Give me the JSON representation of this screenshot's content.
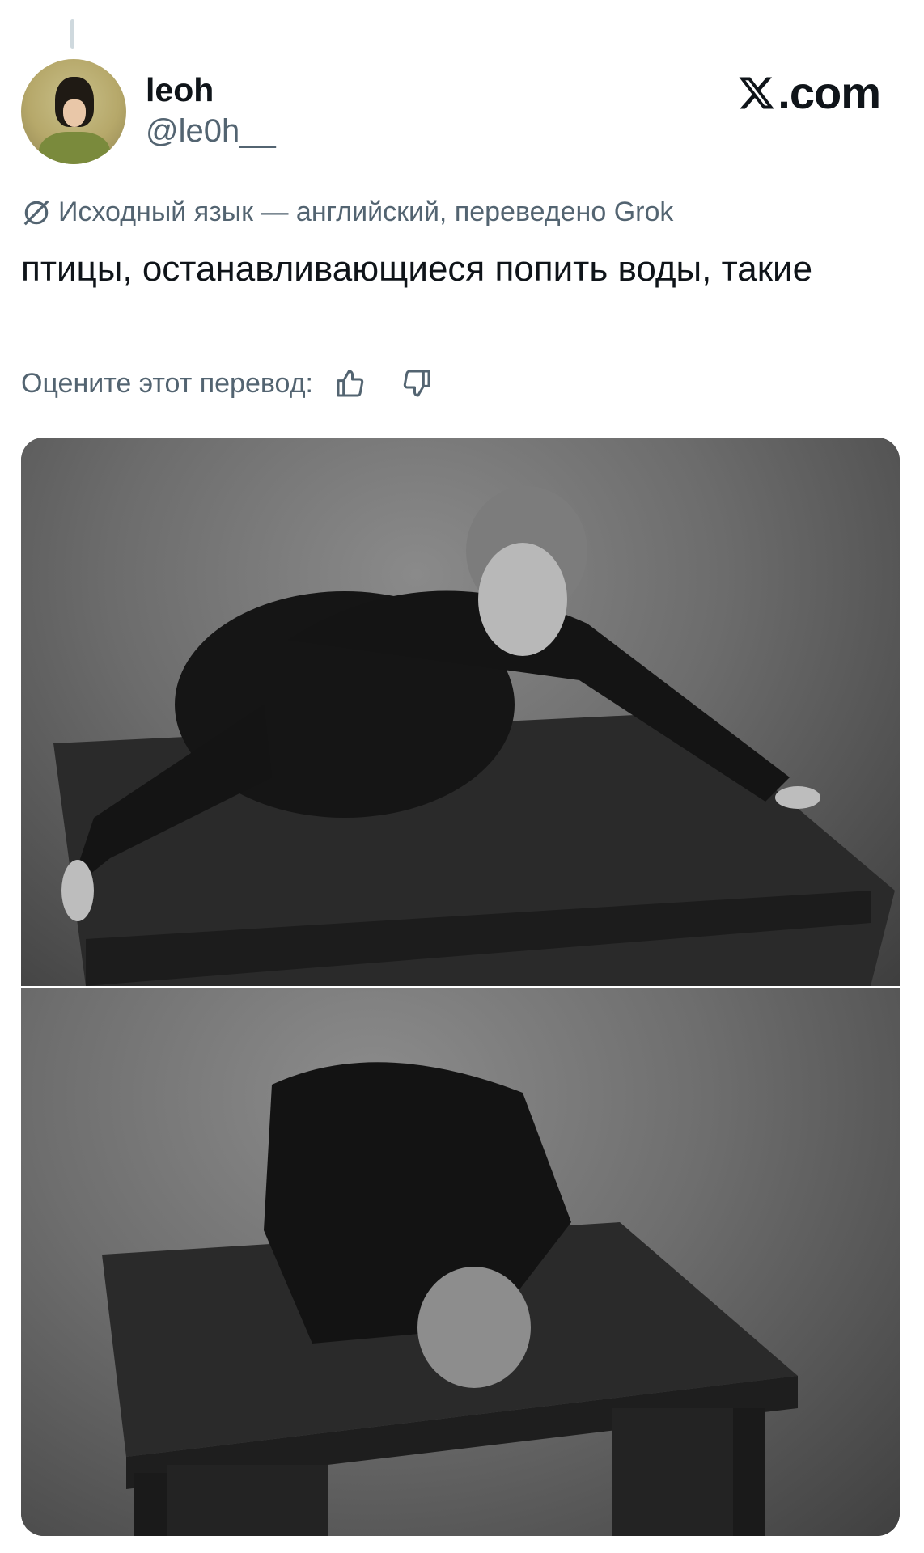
{
  "user": {
    "display_name": "leoh",
    "handle": "@le0h__"
  },
  "brand": {
    "logo_icon": "x-logo-icon",
    "domain_suffix": ".com"
  },
  "translation": {
    "icon": "globe-slash-icon",
    "note": "Исходный язык — английский, переведено Grok"
  },
  "post": {
    "text": "птицы, останавливающиеся попить воды, такие"
  },
  "rating": {
    "prompt": "Оцените этот перевод:",
    "like_icon": "thumbs-up-icon",
    "dislike_icon": "thumbs-down-icon"
  },
  "media": {
    "photo_count": 2
  },
  "colors": {
    "text_primary": "#0f1419",
    "text_secondary": "#536471",
    "background": "#ffffff"
  }
}
